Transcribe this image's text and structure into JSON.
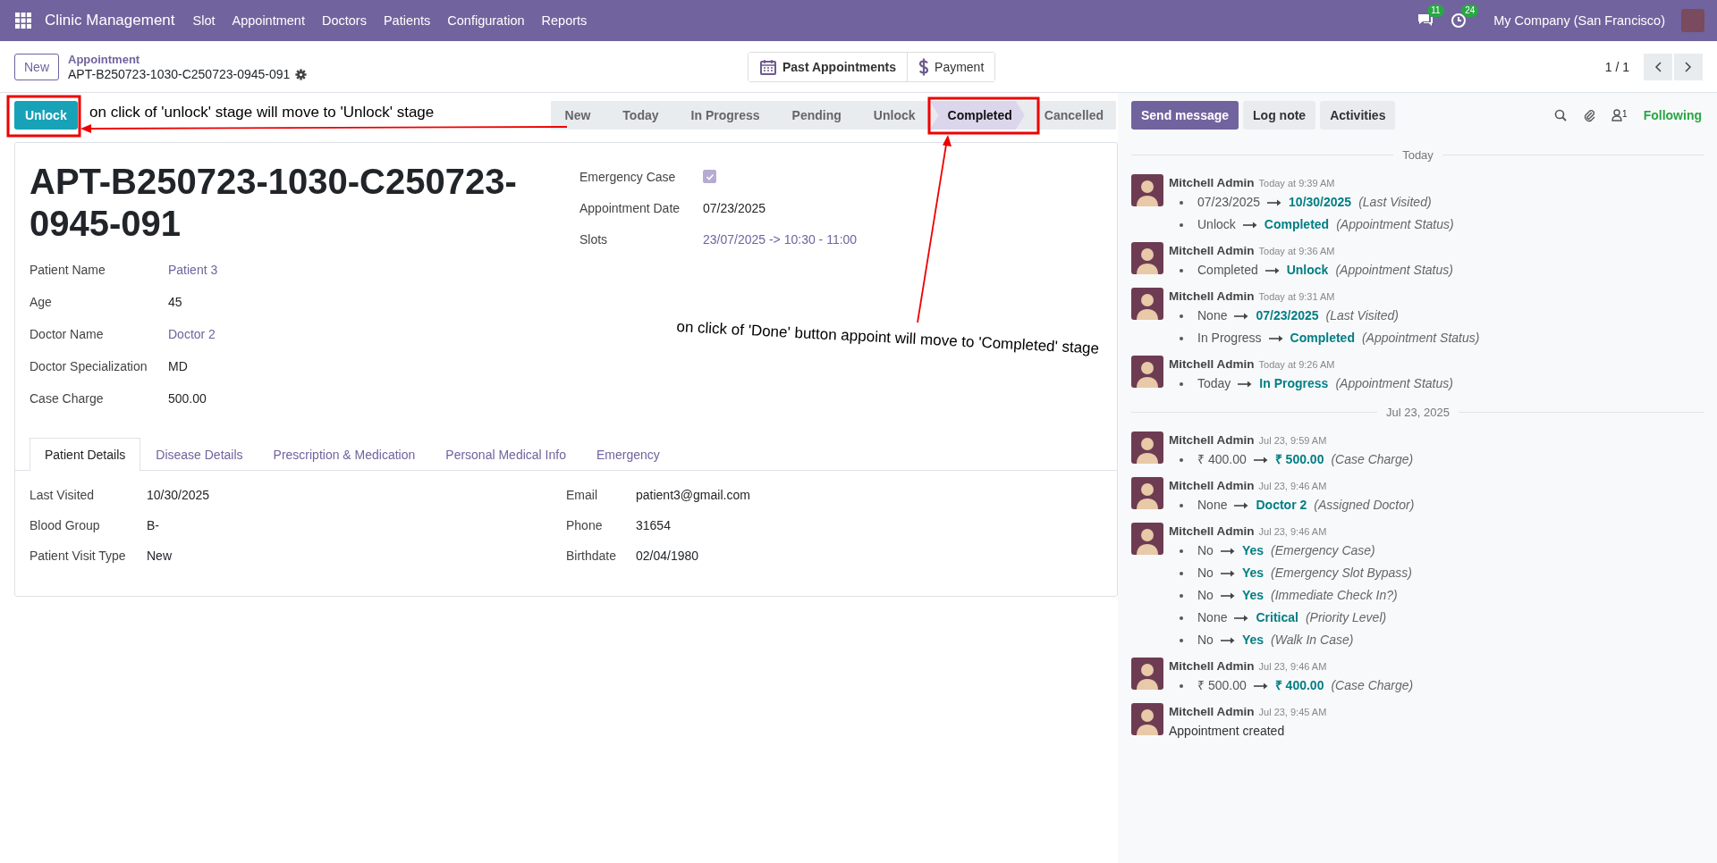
{
  "navbar": {
    "app_name": "Clinic Management",
    "menu": [
      "Slot",
      "Appointment",
      "Doctors",
      "Patients",
      "Configuration",
      "Reports"
    ],
    "messages_count": "11",
    "activities_count": "24",
    "company": "My Company (San Francisco)"
  },
  "control_panel": {
    "new_button": "New",
    "parent": "Appointment",
    "record": "APT-B250723-1030-C250723-0945-091",
    "pager": "1 / 1",
    "smart_buttons": [
      {
        "label": "Past Appointments",
        "kind": "calendar"
      },
      {
        "label": "Payment",
        "kind": "dollar"
      }
    ]
  },
  "header_button": "Unlock",
  "stages": [
    {
      "label": "New",
      "selected": false
    },
    {
      "label": "Today",
      "selected": false
    },
    {
      "label": "In Progress",
      "selected": false
    },
    {
      "label": "Pending",
      "selected": false
    },
    {
      "label": "Unlock",
      "selected": false
    },
    {
      "label": "Completed",
      "selected": true
    },
    {
      "label": "Cancelled",
      "selected": false
    }
  ],
  "form": {
    "title": "APT-B250723-1030-C250723-0945-091",
    "left_fields": [
      {
        "label": "Patient Name",
        "value": "Patient 3",
        "kind": "link"
      },
      {
        "label": "Age",
        "value": "45",
        "kind": "text"
      },
      {
        "label": "Doctor Name",
        "value": "Doctor 2",
        "kind": "link"
      },
      {
        "label": "Doctor Specialization",
        "value": "MD",
        "kind": "text"
      },
      {
        "label": "Case Charge",
        "value": "500.00",
        "kind": "text"
      }
    ],
    "right_fields": [
      {
        "label": "Emergency Case",
        "kind": "checkbox",
        "checked": true
      },
      {
        "label": "Appointment Date",
        "value": "07/23/2025",
        "kind": "text"
      },
      {
        "label": "Slots",
        "value": "23/07/2025 -> 10:30 - 11:00",
        "kind": "link"
      }
    ],
    "tabs": [
      {
        "label": "Patient Details",
        "selected": true
      },
      {
        "label": "Disease Details",
        "selected": false
      },
      {
        "label": "Prescription & Medication",
        "selected": false
      },
      {
        "label": "Personal Medical Info",
        "selected": false
      },
      {
        "label": "Emergency",
        "selected": false
      }
    ],
    "tab_left_fields": [
      {
        "label": "Last Visited",
        "value": "10/30/2025"
      },
      {
        "label": "Blood Group",
        "value": "B-"
      },
      {
        "label": "Patient Visit Type",
        "value": "New"
      }
    ],
    "tab_right_fields": [
      {
        "label": "Email",
        "value": "patient3@gmail.com"
      },
      {
        "label": "Phone",
        "value": "31654"
      },
      {
        "label": "Birthdate",
        "value": "02/04/1980"
      }
    ]
  },
  "chatter": {
    "buttons": [
      {
        "label": "Send message",
        "kind": "primary"
      },
      {
        "label": "Log note",
        "kind": "secondary"
      },
      {
        "label": "Activities",
        "kind": "secondary"
      }
    ],
    "followers_count": "1",
    "follow_label": "Following",
    "groups": [
      {
        "date": "Today",
        "messages": [
          {
            "author": "Mitchell Admin",
            "time": "Today at 9:39 AM",
            "changes": [
              {
                "old": "07/23/2025",
                "new": "10/30/2025",
                "field": "(Last Visited)"
              },
              {
                "old": "Unlock",
                "new": "Completed",
                "field": "(Appointment Status)"
              }
            ]
          },
          {
            "author": "Mitchell Admin",
            "time": "Today at 9:36 AM",
            "changes": [
              {
                "old": "Completed",
                "new": "Unlock",
                "field": "(Appointment Status)"
              }
            ]
          },
          {
            "author": "Mitchell Admin",
            "time": "Today at 9:31 AM",
            "changes": [
              {
                "old": "None",
                "new": "07/23/2025",
                "field": "(Last Visited)"
              },
              {
                "old": "In Progress",
                "new": "Completed",
                "field": "(Appointment Status)"
              }
            ]
          },
          {
            "author": "Mitchell Admin",
            "time": "Today at 9:26 AM",
            "changes": [
              {
                "old": "Today",
                "new": "In Progress",
                "field": "(Appointment Status)"
              }
            ]
          }
        ]
      },
      {
        "date": "Jul 23, 2025",
        "messages": [
          {
            "author": "Mitchell Admin",
            "time": "Jul 23, 9:59 AM",
            "changes": [
              {
                "old": "₹ 400.00",
                "new": "₹ 500.00",
                "field": "(Case Charge)"
              }
            ]
          },
          {
            "author": "Mitchell Admin",
            "time": "Jul 23, 9:46 AM",
            "changes": [
              {
                "old": "None",
                "new": "Doctor 2",
                "field": "(Assigned Doctor)"
              }
            ]
          },
          {
            "author": "Mitchell Admin",
            "time": "Jul 23, 9:46 AM",
            "changes": [
              {
                "old": "No",
                "new": "Yes",
                "field": "(Emergency Case)"
              },
              {
                "old": "No",
                "new": "Yes",
                "field": "(Emergency Slot Bypass)"
              },
              {
                "old": "No",
                "new": "Yes",
                "field": "(Immediate Check In?)"
              },
              {
                "old": "None",
                "new": "Critical",
                "field": "(Priority Level)"
              },
              {
                "old": "No",
                "new": "Yes",
                "field": "(Walk In Case)"
              }
            ]
          },
          {
            "author": "Mitchell Admin",
            "time": "Jul 23, 9:46 AM",
            "changes": [
              {
                "old": "₹ 500.00",
                "new": "₹ 400.00",
                "field": "(Case Charge)"
              }
            ]
          },
          {
            "author": "Mitchell Admin",
            "time": "Jul 23, 9:45 AM",
            "body": "Appointment created"
          }
        ]
      }
    ]
  },
  "annotations": [
    "on click of 'unlock' stage will move to 'Unlock' stage",
    "on click of 'Done' button appoint will move to 'Completed' stage"
  ]
}
